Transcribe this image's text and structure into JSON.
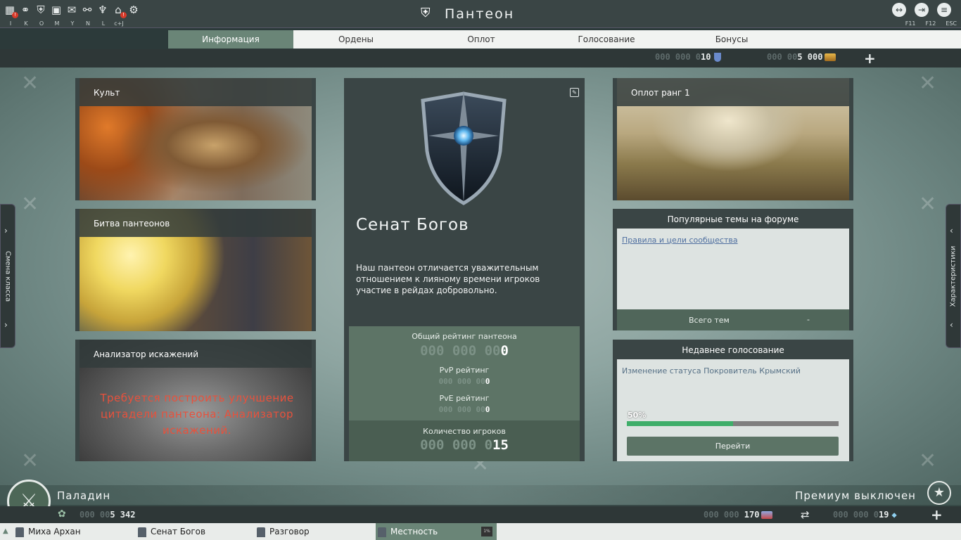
{
  "header": {
    "title": "Пантеон",
    "top_icons": [
      "map-icon",
      "network-icon",
      "shield-icon",
      "contacts-icon",
      "mail-icon",
      "handshake-icon",
      "mask-icon",
      "house-icon",
      "gear-icon"
    ],
    "hotkeys": [
      "I",
      "K",
      "O",
      "M",
      "Y",
      "N",
      "L",
      "c+J"
    ],
    "right_keys": [
      "F11",
      "F12",
      "ESC"
    ]
  },
  "tabs": [
    {
      "label": "Информация",
      "active": true
    },
    {
      "label": "Ордены",
      "active": false
    },
    {
      "label": "Оплот",
      "active": false
    },
    {
      "label": "Голосование",
      "active": false
    },
    {
      "label": "Бонусы",
      "active": false
    }
  ],
  "currency_top": {
    "pantheon_points_dim": "000 000 0",
    "pantheon_points": "10",
    "gold_dim": "000 00",
    "gold": "5 000"
  },
  "side": {
    "left_label": "Смена класса",
    "right_label": "Характеристики"
  },
  "cards": {
    "cult": "Культ",
    "battle": "Битва пантеонов",
    "analyzer": "Анализатор искажений",
    "analyzer_warning": "Требуется построить улучшение цитадели пантеона: Анализатор искажений.",
    "fort": "Оплот ранг 1"
  },
  "pantheon": {
    "name": "Сенат Богов",
    "description": "Наш пантеон отличается уважительным отношением к лияному времени игроков участие в рейдах добровольно.",
    "total_rating_label": "Общий рейтинг пантеона",
    "total_rating_dim": "000 000 00",
    "total_rating": "0",
    "pvp_label": "PvP рейтинг",
    "pvp_dim": "000 000 00",
    "pvp": "0",
    "pve_label": "PvE рейтинг",
    "pve_dim": "000 000 00",
    "pve": "0",
    "players_label": "Количество игроков",
    "players_dim": "000 000 0",
    "players": "15"
  },
  "forum": {
    "header": "Популярные темы на форуме",
    "topic": "Правила и цели сообщества",
    "total_label": "Всего тем",
    "total_value": "-"
  },
  "vote": {
    "header": "Недавнее голосование",
    "text": "Изменение статуса Покровитель Крымский",
    "percent_label": "50%",
    "percent": 0.5,
    "button": "Перейти"
  },
  "bottom": {
    "class_name": "Паладин",
    "premium": "Премиум выключен",
    "left_dim": "000 00",
    "left_val": "5 342",
    "mid_dim": "000 000 ",
    "mid_val": "170",
    "right_dim": "000 000 0",
    "right_val": "19"
  },
  "taskbar": [
    "Миха Архан",
    "Сенат Богов",
    "Разговор",
    "Местность"
  ],
  "colors": {
    "accent": "#6a8577",
    "warning": "#e8513c",
    "progress": "#3fae6a"
  }
}
